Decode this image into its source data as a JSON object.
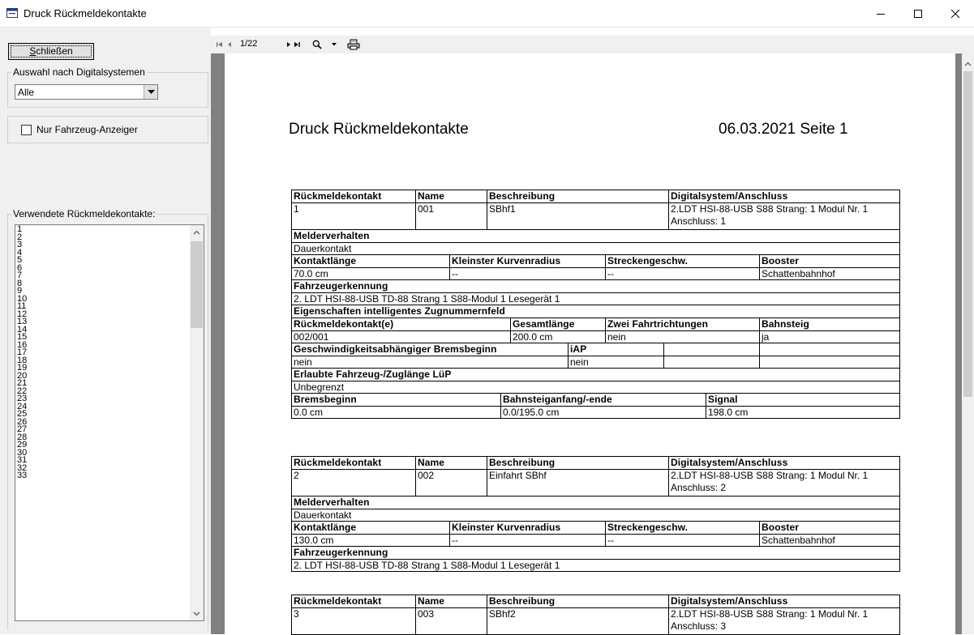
{
  "window": {
    "title": "Druck Rückmeldekontakte"
  },
  "left": {
    "close_button": "Schließen",
    "group_digital": "Auswahl nach Digitalsystemen",
    "combo_value": "Alle",
    "checkbox_label": "Nur Fahrzeug-Anzeiger",
    "group_used": "Verwendete Rückmeldekontakte:",
    "contacts": [
      "1",
      "2",
      "3",
      "4",
      "5",
      "6",
      "7",
      "8",
      "9",
      "10",
      "11",
      "12",
      "13",
      "14",
      "15",
      "16",
      "17",
      "18",
      "19",
      "20",
      "21",
      "22",
      "23",
      "24",
      "25",
      "26",
      "27",
      "28",
      "29",
      "30",
      "31",
      "32",
      "33"
    ]
  },
  "toolbar": {
    "page_indicator": "1/22"
  },
  "report": {
    "title": "Druck Rückmeldekontakte",
    "date_page": "06.03.2021 Seite 1",
    "labels": {
      "contact": "Rückmeldekontakt",
      "name": "Name",
      "description": "Beschreibung",
      "digital": "Digitalsystem/Anschluss",
      "behaviour": "Melderverhalten",
      "length": "Kontaktlänge",
      "radius": "Kleinster Kurvenradius",
      "speed": "Streckengeschw.",
      "booster": "Booster",
      "vehicle_id": "Fahrzeugerkennung",
      "iz_props": "Eigenschaften intelligentes Zugnummernfeld",
      "contacts": "Rückmeldekontakt(e)",
      "total_length": "Gesamtlänge",
      "two_dir": "Zwei Fahrtrichtungen",
      "platform": "Bahnsteig",
      "speed_brake": "Geschwindigkeitsabhängiger Bremsbeginn",
      "iap": "iAP",
      "allowed_length": "Erlaubte Fahrzeug-/Zuglänge LüP",
      "brake_start": "Bremsbeginn",
      "platform_range": "Bahnsteiganfang/-ende",
      "signal": "Signal"
    },
    "entries": [
      {
        "contact": "1",
        "name": "001",
        "description": "SBhf1",
        "digital": "2.LDT HSI-88-USB S88 Strang: 1 Modul Nr. 1 Anschluss: 1",
        "behaviour": "Dauerkontakt",
        "length": "70.0 cm",
        "radius": "--",
        "speed": "--",
        "booster": "Schattenbahnhof",
        "vehicle_id": "2. LDT HSI-88-USB TD-88 Strang 1 S88-Modul 1 Lesegerät 1",
        "contacts": "002/001",
        "total_length": "200.0 cm",
        "two_dir": "nein",
        "platform": "ja",
        "speed_brake": "nein",
        "iap": "nein",
        "allowed_length": "Unbegrenzt",
        "brake_start": "0.0 cm",
        "platform_range": "0.0/195.0 cm",
        "signal": "198.0 cm"
      },
      {
        "contact": "2",
        "name": "002",
        "description": "Einfahrt SBhf",
        "digital": "2.LDT HSI-88-USB S88 Strang: 1 Modul Nr. 1 Anschluss: 2",
        "behaviour": "Dauerkontakt",
        "length": "130.0 cm",
        "radius": "--",
        "speed": "--",
        "booster": "Schattenbahnhof",
        "vehicle_id": "2. LDT HSI-88-USB TD-88 Strang 1 S88-Modul 1 Lesegerät 1"
      },
      {
        "contact": "3",
        "name": "003",
        "description": "SBhf2",
        "digital": "2.LDT HSI-88-USB S88 Strang: 1 Modul Nr. 1 Anschluss: 3"
      }
    ]
  }
}
